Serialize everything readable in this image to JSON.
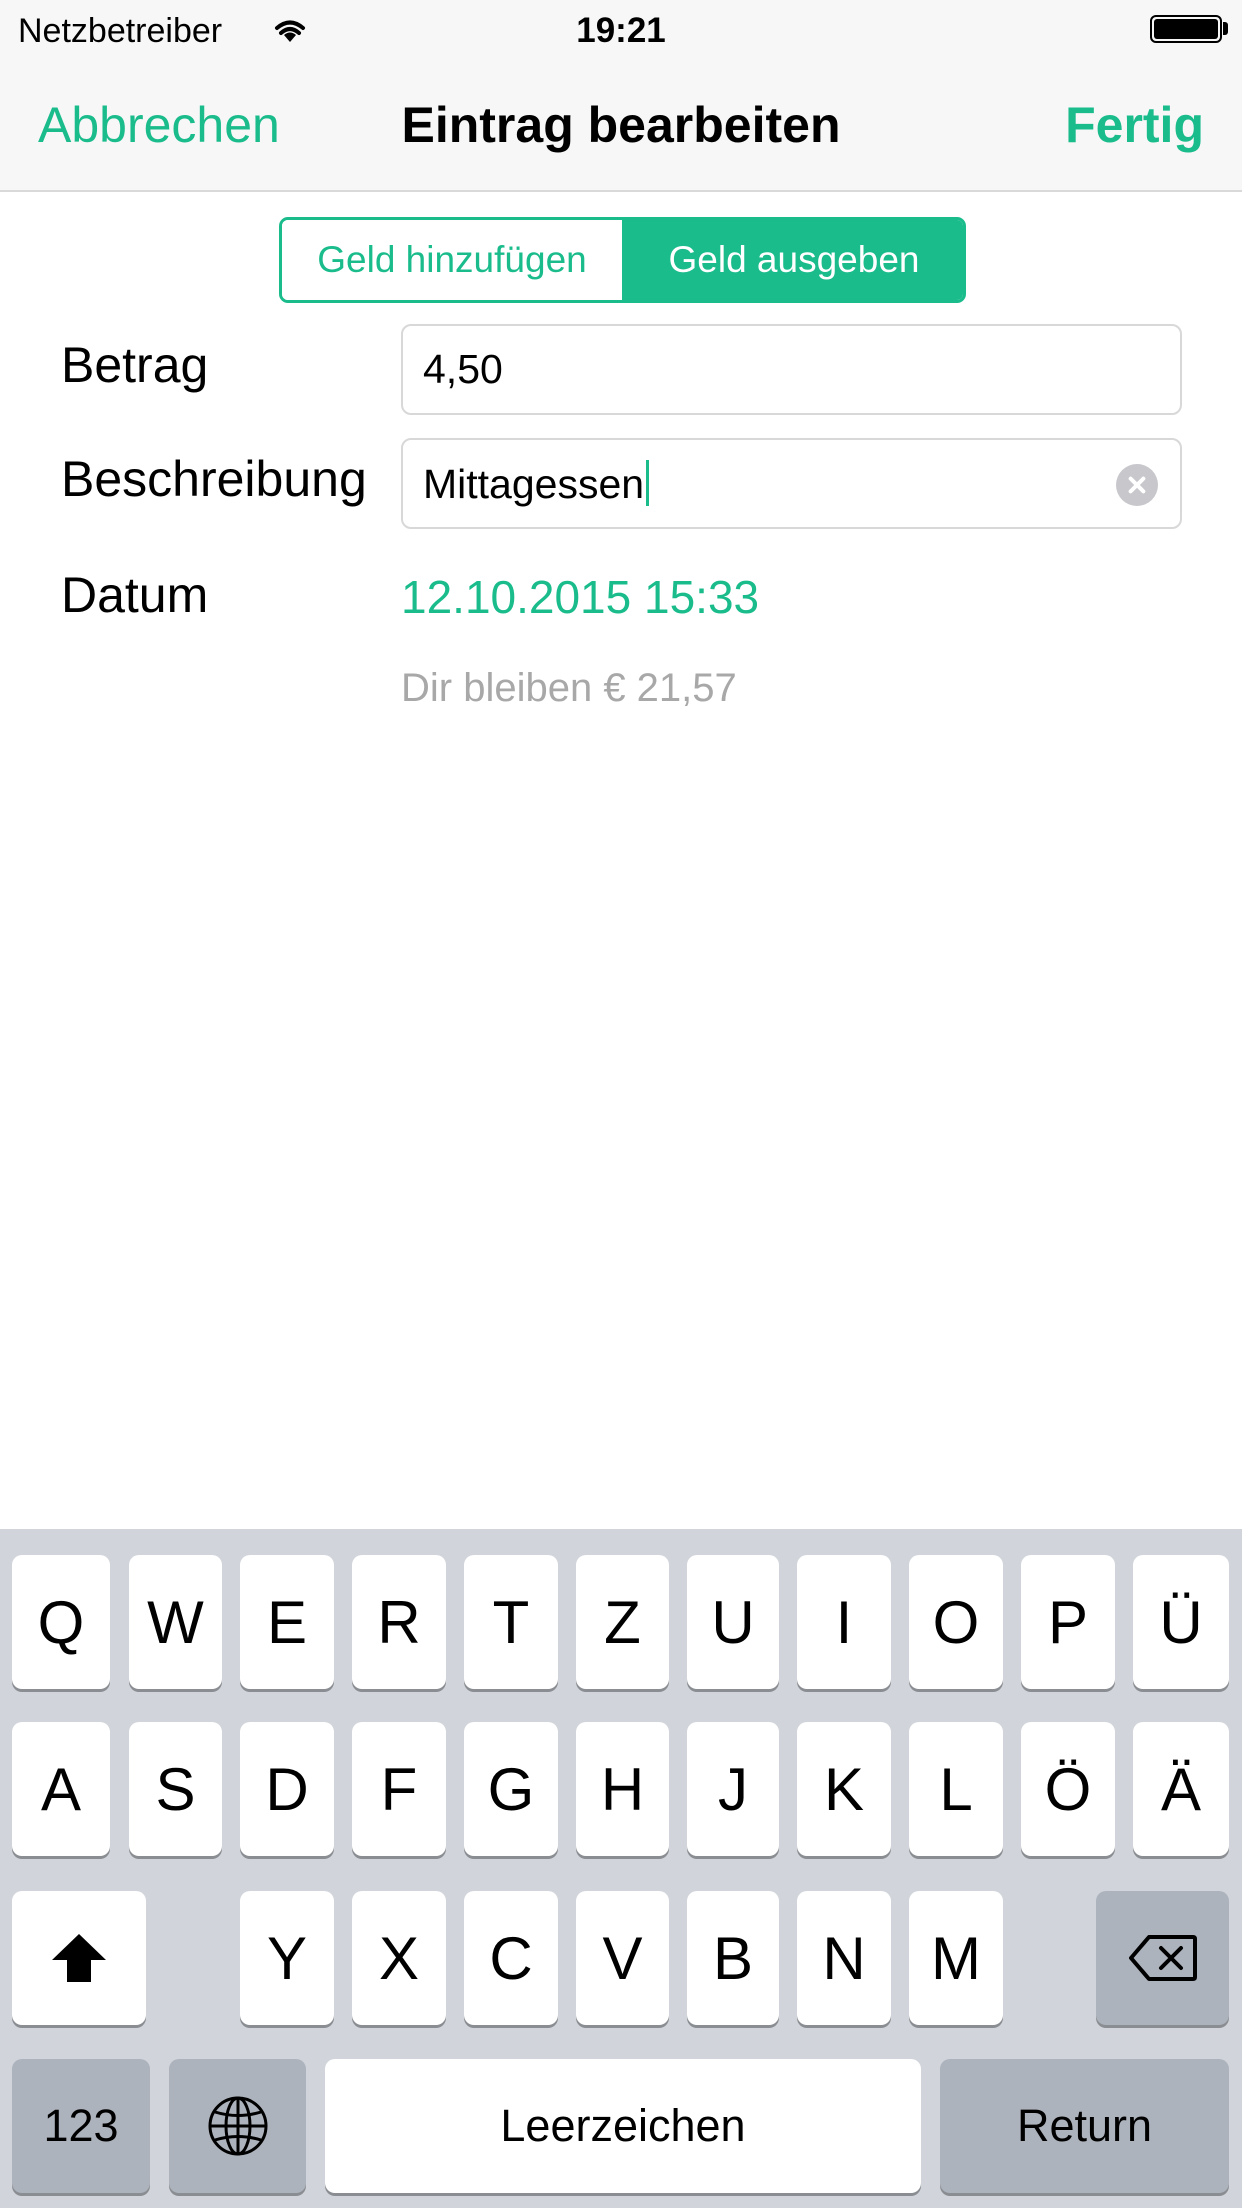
{
  "status_bar": {
    "carrier": "Netzbetreiber",
    "time": "19:21",
    "wifi_icon": "wifi-icon",
    "battery_icon": "battery-icon"
  },
  "nav": {
    "cancel": "Abbrechen",
    "title": "Eintrag bearbeiten",
    "done": "Fertig"
  },
  "segmented": {
    "add": "Geld hinzufügen",
    "spend": "Geld ausgeben",
    "selected": "Geld ausgeben"
  },
  "form": {
    "amount_label": "Betrag",
    "amount_value": "4,50",
    "description_label": "Beschreibung",
    "description_value": "Mittagessen",
    "date_label": "Datum",
    "date_value": "12.10.2015 15:33",
    "remaining": "Dir bleiben € 21,57"
  },
  "keyboard": {
    "row1": [
      "Q",
      "W",
      "E",
      "R",
      "T",
      "Z",
      "U",
      "I",
      "O",
      "P",
      "Ü"
    ],
    "row2": [
      "A",
      "S",
      "D",
      "F",
      "G",
      "H",
      "J",
      "K",
      "L",
      "Ö",
      "Ä"
    ],
    "row3": [
      "Y",
      "X",
      "C",
      "V",
      "B",
      "N",
      "M"
    ],
    "numbers": "123",
    "space": "Leerzeichen",
    "return": "Return",
    "shift_icon": "shift-icon",
    "delete_icon": "backspace-icon",
    "globe_icon": "globe-icon"
  },
  "colors": {
    "accent": "#1abc8c",
    "placeholder_gray": "#a8a8a8",
    "keyboard_bg": "#d1d5db"
  }
}
